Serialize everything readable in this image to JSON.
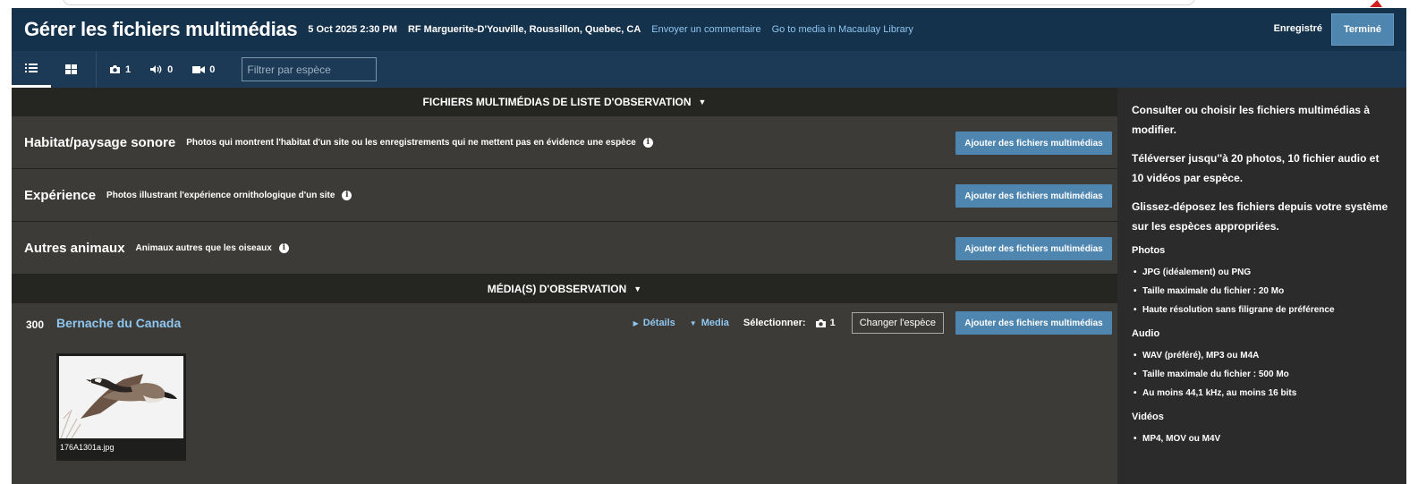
{
  "header": {
    "title": "Gérer les fichiers multimédias",
    "date": "5 Oct 2025 2:30 PM",
    "location": "RF Marguerite-D'Youville, Roussillon, Quebec, CA",
    "feedback_link": "Envoyer un commentaire",
    "macaulay_link": "Go to media in Macaulay Library",
    "saved_status": "Enregistré",
    "done_label": "Terminé"
  },
  "toolbar": {
    "photo_count": "1",
    "audio_count": "0",
    "video_count": "0",
    "filter_placeholder": "Filtrer par espèce"
  },
  "checklist_section": {
    "title": "FICHIERS MULTIMÉDIAS DE LISTE D'OBSERVATION",
    "categories": [
      {
        "name": "Habitat/paysage sonore",
        "description": "Photos qui montrent l'habitat d'un site ou les enregistrements qui ne mettent pas en évidence une espèce",
        "button": "Ajouter des fichiers multimédias"
      },
      {
        "name": "Expérience",
        "description": "Photos illustrant l'expérience ornithologique d'un site",
        "button": "Ajouter des fichiers multimédias"
      },
      {
        "name": "Autres animaux",
        "description": "Animaux autres que les oiseaux",
        "button": "Ajouter des fichiers multimédias"
      }
    ]
  },
  "observation_section": {
    "title": "MÉDIA(S) D'OBSERVATION",
    "species": {
      "number": "300",
      "name": "Bernache du Canada",
      "details_label": "Détails",
      "media_label": "Media",
      "select_label": "Sélectionner:",
      "select_count": "1",
      "change_label": "Changer l'espèce",
      "add_label": "Ajouter des fichiers multimédias",
      "photo_filename": "176A1301a.jpg"
    }
  },
  "sidebar": {
    "intro": "Consulter ou choisir les fichiers multimédias à modifier.",
    "limits": "Téléverser jusqu''à 20 photos, 10 fichier audio et 10 vidéos par espèce.",
    "dragdrop": "Glissez-déposez les fichiers depuis votre système sur les espèces appropriées.",
    "photos_heading": "Photos",
    "photos_items": [
      "JPG (idéalement) ou PNG",
      "Taille maximale du fichier : 20 Mo",
      "Haute résolution sans filigrane de préférence"
    ],
    "audio_heading": "Audio",
    "audio_items": [
      "WAV (préféré), MP3 ou M4A",
      "Taille maximale du fichier : 500 Mo",
      "Au moins 44,1 kHz, au moins 16 bits"
    ],
    "video_heading": "Vidéos",
    "video_items": [
      "MP4, MOV ou M4V"
    ]
  },
  "colors": {
    "header_bg": "#15324d",
    "toolbar_bg": "#1c3a55",
    "accent_button": "#4f86b0",
    "link": "#8fc6ef",
    "panel_bg": "#3c3b37",
    "section_header_bg": "#252521"
  }
}
